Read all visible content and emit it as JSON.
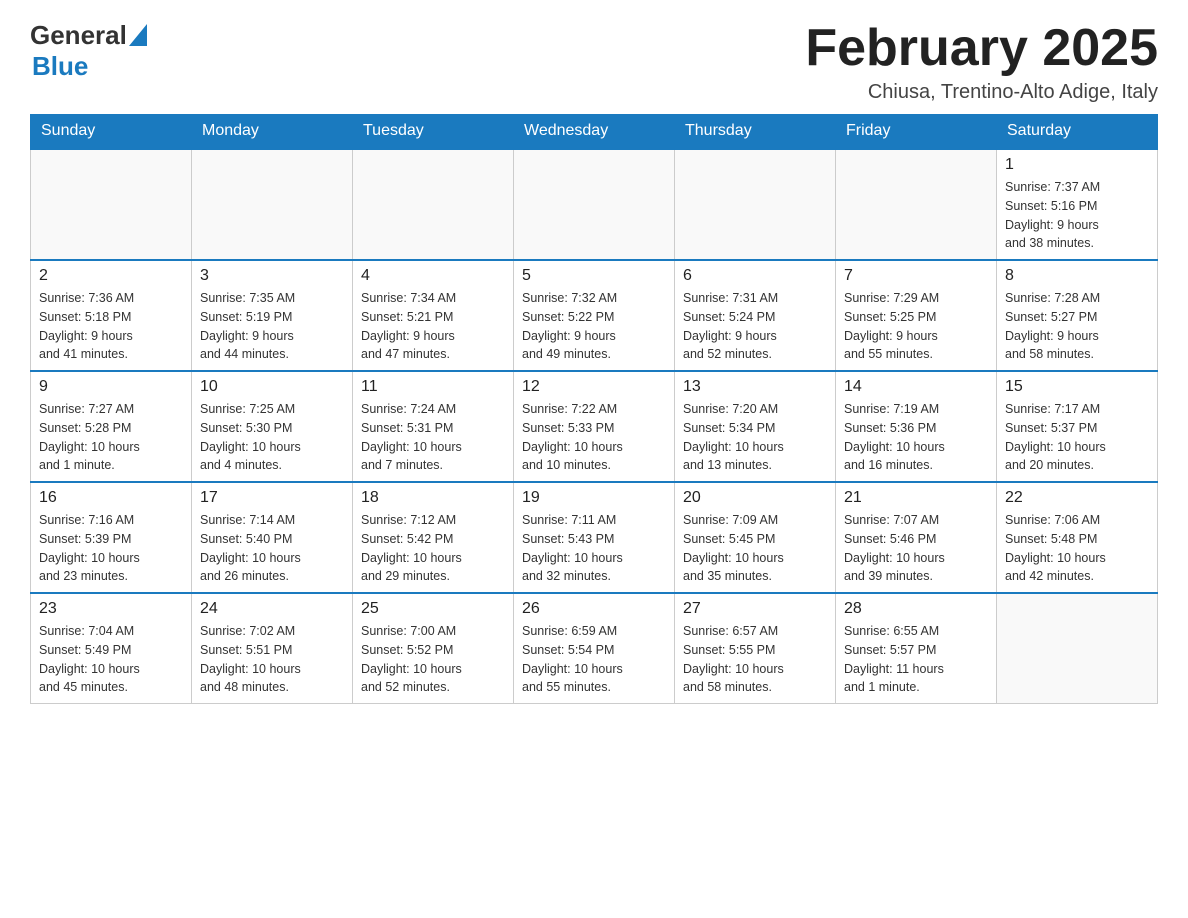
{
  "header": {
    "logo_general": "General",
    "logo_blue": "Blue",
    "month_title": "February 2025",
    "location": "Chiusa, Trentino-Alto Adige, Italy"
  },
  "days_of_week": [
    "Sunday",
    "Monday",
    "Tuesday",
    "Wednesday",
    "Thursday",
    "Friday",
    "Saturday"
  ],
  "weeks": [
    [
      {
        "day": "",
        "info": ""
      },
      {
        "day": "",
        "info": ""
      },
      {
        "day": "",
        "info": ""
      },
      {
        "day": "",
        "info": ""
      },
      {
        "day": "",
        "info": ""
      },
      {
        "day": "",
        "info": ""
      },
      {
        "day": "1",
        "info": "Sunrise: 7:37 AM\nSunset: 5:16 PM\nDaylight: 9 hours\nand 38 minutes."
      }
    ],
    [
      {
        "day": "2",
        "info": "Sunrise: 7:36 AM\nSunset: 5:18 PM\nDaylight: 9 hours\nand 41 minutes."
      },
      {
        "day": "3",
        "info": "Sunrise: 7:35 AM\nSunset: 5:19 PM\nDaylight: 9 hours\nand 44 minutes."
      },
      {
        "day": "4",
        "info": "Sunrise: 7:34 AM\nSunset: 5:21 PM\nDaylight: 9 hours\nand 47 minutes."
      },
      {
        "day": "5",
        "info": "Sunrise: 7:32 AM\nSunset: 5:22 PM\nDaylight: 9 hours\nand 49 minutes."
      },
      {
        "day": "6",
        "info": "Sunrise: 7:31 AM\nSunset: 5:24 PM\nDaylight: 9 hours\nand 52 minutes."
      },
      {
        "day": "7",
        "info": "Sunrise: 7:29 AM\nSunset: 5:25 PM\nDaylight: 9 hours\nand 55 minutes."
      },
      {
        "day": "8",
        "info": "Sunrise: 7:28 AM\nSunset: 5:27 PM\nDaylight: 9 hours\nand 58 minutes."
      }
    ],
    [
      {
        "day": "9",
        "info": "Sunrise: 7:27 AM\nSunset: 5:28 PM\nDaylight: 10 hours\nand 1 minute."
      },
      {
        "day": "10",
        "info": "Sunrise: 7:25 AM\nSunset: 5:30 PM\nDaylight: 10 hours\nand 4 minutes."
      },
      {
        "day": "11",
        "info": "Sunrise: 7:24 AM\nSunset: 5:31 PM\nDaylight: 10 hours\nand 7 minutes."
      },
      {
        "day": "12",
        "info": "Sunrise: 7:22 AM\nSunset: 5:33 PM\nDaylight: 10 hours\nand 10 minutes."
      },
      {
        "day": "13",
        "info": "Sunrise: 7:20 AM\nSunset: 5:34 PM\nDaylight: 10 hours\nand 13 minutes."
      },
      {
        "day": "14",
        "info": "Sunrise: 7:19 AM\nSunset: 5:36 PM\nDaylight: 10 hours\nand 16 minutes."
      },
      {
        "day": "15",
        "info": "Sunrise: 7:17 AM\nSunset: 5:37 PM\nDaylight: 10 hours\nand 20 minutes."
      }
    ],
    [
      {
        "day": "16",
        "info": "Sunrise: 7:16 AM\nSunset: 5:39 PM\nDaylight: 10 hours\nand 23 minutes."
      },
      {
        "day": "17",
        "info": "Sunrise: 7:14 AM\nSunset: 5:40 PM\nDaylight: 10 hours\nand 26 minutes."
      },
      {
        "day": "18",
        "info": "Sunrise: 7:12 AM\nSunset: 5:42 PM\nDaylight: 10 hours\nand 29 minutes."
      },
      {
        "day": "19",
        "info": "Sunrise: 7:11 AM\nSunset: 5:43 PM\nDaylight: 10 hours\nand 32 minutes."
      },
      {
        "day": "20",
        "info": "Sunrise: 7:09 AM\nSunset: 5:45 PM\nDaylight: 10 hours\nand 35 minutes."
      },
      {
        "day": "21",
        "info": "Sunrise: 7:07 AM\nSunset: 5:46 PM\nDaylight: 10 hours\nand 39 minutes."
      },
      {
        "day": "22",
        "info": "Sunrise: 7:06 AM\nSunset: 5:48 PM\nDaylight: 10 hours\nand 42 minutes."
      }
    ],
    [
      {
        "day": "23",
        "info": "Sunrise: 7:04 AM\nSunset: 5:49 PM\nDaylight: 10 hours\nand 45 minutes."
      },
      {
        "day": "24",
        "info": "Sunrise: 7:02 AM\nSunset: 5:51 PM\nDaylight: 10 hours\nand 48 minutes."
      },
      {
        "day": "25",
        "info": "Sunrise: 7:00 AM\nSunset: 5:52 PM\nDaylight: 10 hours\nand 52 minutes."
      },
      {
        "day": "26",
        "info": "Sunrise: 6:59 AM\nSunset: 5:54 PM\nDaylight: 10 hours\nand 55 minutes."
      },
      {
        "day": "27",
        "info": "Sunrise: 6:57 AM\nSunset: 5:55 PM\nDaylight: 10 hours\nand 58 minutes."
      },
      {
        "day": "28",
        "info": "Sunrise: 6:55 AM\nSunset: 5:57 PM\nDaylight: 11 hours\nand 1 minute."
      },
      {
        "day": "",
        "info": ""
      }
    ]
  ]
}
